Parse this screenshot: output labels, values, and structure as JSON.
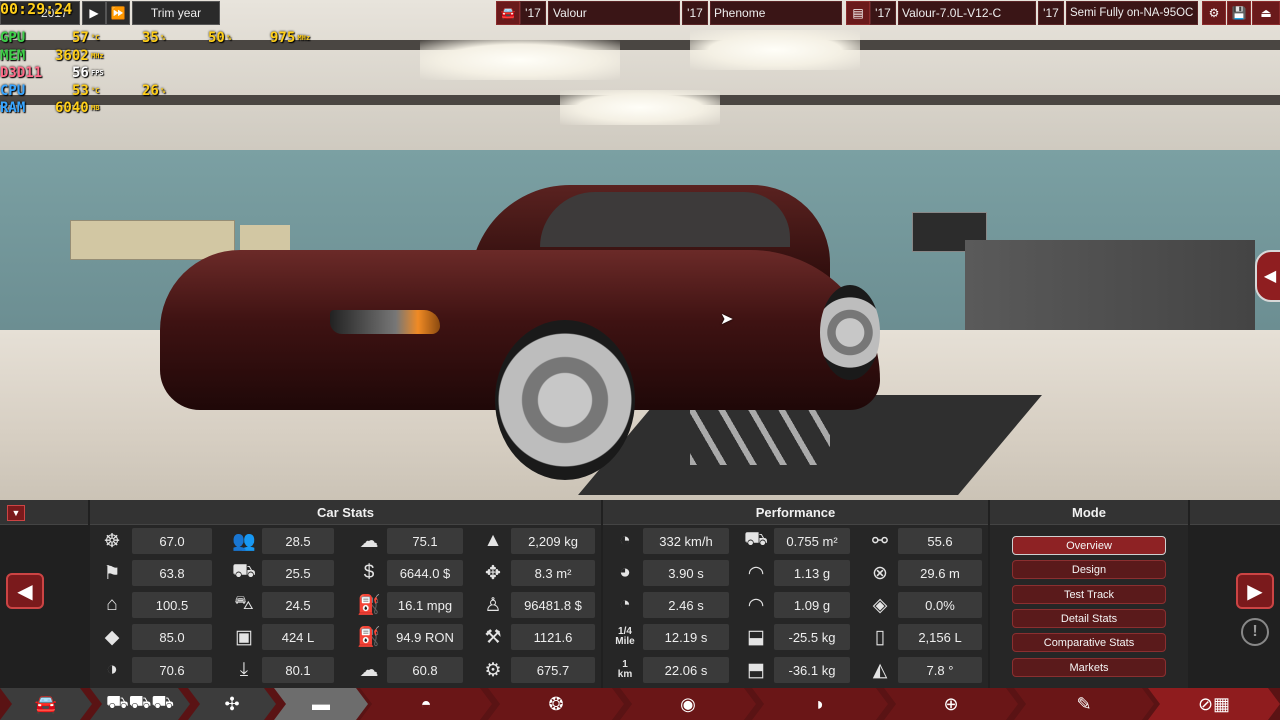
{
  "overlay": {
    "clock": "00:29:24",
    "rows": [
      {
        "label": "GPU",
        "cls": "",
        "items": [
          {
            "v": "57",
            "u": "°C"
          },
          {
            "v": "35",
            "u": "%"
          },
          {
            "v": "50",
            "u": "%"
          },
          {
            "v": "975",
            "u": "MHz"
          }
        ]
      },
      {
        "label": "MEM",
        "cls": "",
        "items": [
          {
            "v": "3602",
            "u": "MHz"
          }
        ]
      },
      {
        "label": "D3D11",
        "cls": "pink",
        "items": [
          {
            "v": "56",
            "u": "FPS",
            "white": true
          }
        ]
      },
      {
        "label": "CPU",
        "cls": "blue",
        "items": [
          {
            "v": "53",
            "u": "°C"
          },
          {
            "v": "26",
            "u": "%"
          }
        ]
      },
      {
        "label": "RAM",
        "cls": "blue",
        "items": [
          {
            "v": "6040",
            "u": "MB"
          }
        ]
      }
    ]
  },
  "topbar": {
    "year_partial": "2017",
    "trim_year": "Trim year",
    "body_year": "'17",
    "body_name": "Valour",
    "trim_year2": "'17",
    "trim_name": "Phenome",
    "engine_year": "'17",
    "engine_name": "Valour-7.0L-V12-C",
    "variant_year": "'17",
    "variant_name": "Semi Fully on-NA-95OC"
  },
  "panels": {
    "car_stats": "Car Stats",
    "performance": "Performance",
    "mode": "Mode"
  },
  "car_stats": [
    [
      {
        "icon": "steering-wheel-icon",
        "g": "☸",
        "v": "67.0"
      },
      {
        "icon": "passengers-icon",
        "g": "👥",
        "v": "28.5"
      },
      {
        "icon": "brain-icon",
        "g": "☁",
        "v": "75.1"
      },
      {
        "icon": "weight-icon",
        "g": "▲",
        "v": "2,209 kg"
      }
    ],
    [
      {
        "icon": "race-flag-icon",
        "g": "⚑",
        "v": "63.8"
      },
      {
        "icon": "utility-truck-icon",
        "g": "⛟",
        "v": "25.5"
      },
      {
        "icon": "cost-icon",
        "g": "$",
        "v": "6644.0 $"
      },
      {
        "icon": "arrows-icon",
        "g": "✥",
        "v": "8.3 m²"
      }
    ],
    [
      {
        "icon": "seat-icon",
        "g": "⌂",
        "v": "100.5"
      },
      {
        "icon": "offroad-icon",
        "g": "⛍",
        "v": "24.5"
      },
      {
        "icon": "fuel-can-icon",
        "g": "⛽",
        "v": "16.1 mpg"
      },
      {
        "icon": "worker-cost-icon",
        "g": "♙",
        "v": "96481.8 $"
      }
    ],
    [
      {
        "icon": "diamond-icon",
        "g": "◆",
        "v": "85.0"
      },
      {
        "icon": "cargo-icon",
        "g": "▣",
        "v": "424 L"
      },
      {
        "icon": "fuel-pump-icon",
        "g": "⛽",
        "v": "94.9 RON"
      },
      {
        "icon": "anvil-icon",
        "g": "⚒",
        "v": "1121.6"
      }
    ],
    [
      {
        "icon": "safety-icon",
        "g": "◑",
        "v": "70.6"
      },
      {
        "icon": "reliability-icon",
        "g": "⤓",
        "v": "80.1"
      },
      {
        "icon": "emissions-icon",
        "g": "☁",
        "v": "60.8"
      },
      {
        "icon": "gears-icon",
        "g": "⚙",
        "v": "675.7"
      }
    ]
  ],
  "performance": [
    [
      {
        "icon": "speedometer-icon",
        "g": "◔",
        "v": "332 km/h"
      },
      {
        "icon": "drag-icon",
        "g": "⛟",
        "v": "0.755 m²"
      },
      {
        "icon": "downforce-icon",
        "g": "⚯",
        "v": "55.6"
      }
    ],
    [
      {
        "icon": "accel-100-icon",
        "g": "◕",
        "v": "3.90 s"
      },
      {
        "icon": "grip-icon",
        "g": "◠",
        "v": "1.13 g"
      },
      {
        "icon": "turn-circle-icon",
        "g": "⊗",
        "v": "29.6 m"
      }
    ],
    [
      {
        "icon": "accel-60-icon",
        "g": "◔",
        "v": "2.46 s"
      },
      {
        "icon": "corner-icon",
        "g": "◠",
        "v": "1.09 g"
      },
      {
        "icon": "brake-fade-icon",
        "g": "◈",
        "v": "0.0%"
      }
    ],
    [
      {
        "icon": "quarter-mile-icon",
        "g": "1/4\nMile",
        "small": true,
        "v": "12.19 s"
      },
      {
        "icon": "front-load-icon",
        "g": "⬓",
        "v": "-25.5 kg"
      },
      {
        "icon": "fuel-tank-icon",
        "g": "▯",
        "v": "2,156 L"
      }
    ],
    [
      {
        "icon": "one-km-icon",
        "g": "1\nkm",
        "small": true,
        "v": "22.06 s"
      },
      {
        "icon": "rear-load-icon",
        "g": "⬒",
        "v": "-36.1 kg"
      },
      {
        "icon": "angle-icon",
        "g": "◭",
        "v": "7.8 °"
      }
    ]
  ],
  "modes": [
    {
      "label": "Overview",
      "active": true
    },
    {
      "label": "Design",
      "active": false
    },
    {
      "label": "Test Track",
      "active": false
    },
    {
      "label": "Detail Stats",
      "active": false
    },
    {
      "label": "Comparative Stats",
      "active": false
    },
    {
      "label": "Markets",
      "active": false
    }
  ],
  "tabs": [
    {
      "name": "tab-car-model",
      "icon": "car-icon",
      "g": "🚘",
      "style": "dark"
    },
    {
      "name": "tab-trims",
      "icon": "car-trims-icon",
      "g": "⛟⛟⛟",
      "style": "dark"
    },
    {
      "name": "tab-chassis",
      "icon": "chassis-icon",
      "g": "✣",
      "style": "dark"
    },
    {
      "name": "tab-body",
      "icon": "car-body-icon",
      "g": "▬",
      "style": "sel"
    },
    {
      "name": "tab-fixture",
      "icon": "fixture-icon",
      "g": "◓",
      "style": "red"
    },
    {
      "name": "tab-wheels",
      "icon": "wheel-icon",
      "g": "❂",
      "style": "red"
    },
    {
      "name": "tab-suspension",
      "icon": "suspension-icon",
      "g": "◉",
      "style": "red"
    },
    {
      "name": "tab-aero",
      "icon": "aero-icon",
      "g": "◗",
      "style": "red"
    },
    {
      "name": "tab-interior",
      "icon": "interior-icon",
      "g": "⊕",
      "style": "red"
    },
    {
      "name": "tab-tune",
      "icon": "tune-icon",
      "g": "✎",
      "style": "red"
    },
    {
      "name": "tab-test",
      "icon": "test-flag-icon",
      "g": "⊘▦",
      "style": "redsel"
    }
  ]
}
